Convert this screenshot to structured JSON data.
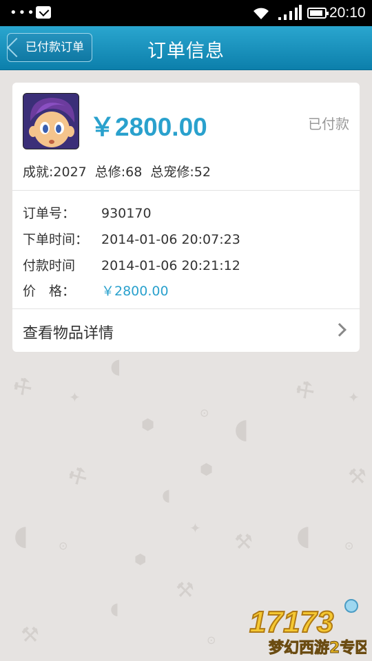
{
  "status_bar": {
    "time": "20:10",
    "icons": [
      "more-icon",
      "mail-icon",
      "wifi-icon",
      "signal-icon",
      "battery-icon"
    ]
  },
  "header": {
    "back_label": "已付款订单",
    "title": "订单信息"
  },
  "order": {
    "price_big": "￥2800.00",
    "status": "已付款",
    "stats": {
      "achievement": "成就:2027",
      "total_cultivation": "总修:68",
      "total_pet_cultivation": "总宠修:52"
    },
    "rows": [
      {
        "label": "订单号：",
        "value": "930170"
      },
      {
        "label": "下单时间：",
        "value": "2014-01-06 20:07:23"
      },
      {
        "label": "付款时间",
        "value": "2014-01-06 20:21:12"
      },
      {
        "label": "价　格：",
        "value": "￥2800.00"
      }
    ],
    "detail_link": "查看物品详情"
  },
  "colors": {
    "accent": "#2aa1cd",
    "header": "#1590bd",
    "background": "#e6e3e1"
  },
  "watermark": {
    "text": "17173",
    "subtext": "梦幻西游2专区"
  }
}
